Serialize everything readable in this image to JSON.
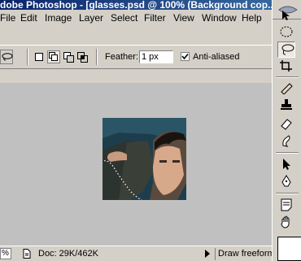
{
  "window": {
    "title": "dobe Photoshop - [glasses.psd @ 100% (Background cop..."
  },
  "menu": [
    "File",
    "Edit",
    "Image",
    "Layer",
    "Select",
    "Filter",
    "View",
    "Window",
    "Help"
  ],
  "options": {
    "feather_label": "Feather:",
    "feather_value": "1 px",
    "antialiased_label": "Anti-aliased",
    "antialiased_checked": true
  },
  "status": {
    "zoom": "%",
    "doc_size": "Doc: 29K/462K",
    "hint": "Draw freeform"
  },
  "toolbox": {
    "tools": [
      "move-tool",
      "elliptical-marquee-tool",
      "lasso-tool",
      "crop-tool",
      "healing-brush-tool",
      "clone-stamp-tool",
      "eraser-tool",
      "blur-tool",
      "path-selection-tool",
      "pen-tool",
      "notes-tool",
      "hand-tool"
    ],
    "active_tool": "lasso-tool"
  },
  "colors": {
    "title_bar": "#0a246a",
    "chrome": "#d4d0c8",
    "workspace": "#c0c0c0"
  }
}
